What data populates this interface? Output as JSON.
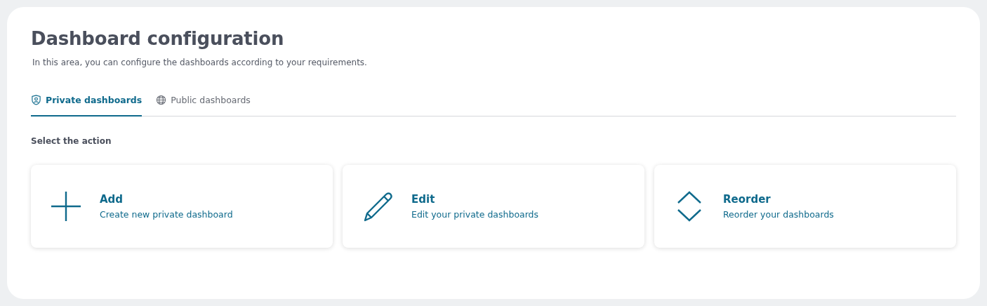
{
  "title": "Dashboard configuration",
  "subtitle": "In this area, you can configure the dashboards according to your requirements.",
  "tabs": [
    {
      "label": "Private dashboards",
      "kind": "shield",
      "selected": true
    },
    {
      "label": "Public dashboards",
      "kind": "globe",
      "selected": false
    }
  ],
  "section_label": "Select the action",
  "actions": [
    {
      "kind": "add",
      "title": "Add",
      "description": "Create new private dashboard"
    },
    {
      "kind": "edit",
      "title": "Edit",
      "description": "Edit your private dashboards"
    },
    {
      "kind": "reorder",
      "title": "Reorder",
      "description": "Reorder your dashboards"
    }
  ]
}
